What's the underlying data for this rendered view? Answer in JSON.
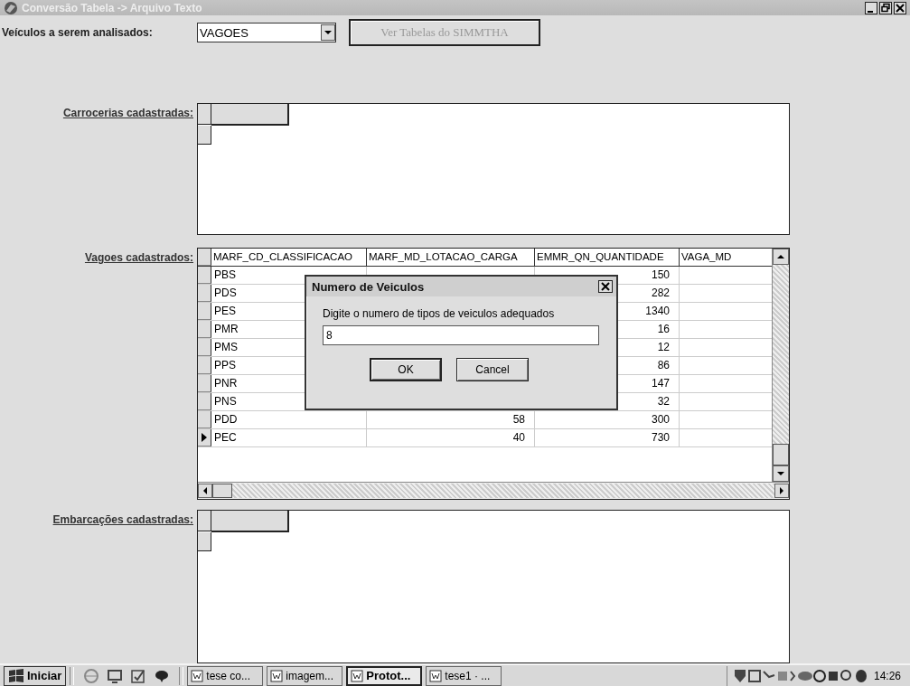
{
  "window": {
    "title": "Conversão Tabela -> Arquivo Texto"
  },
  "vehicle_select": {
    "label": "Veículos a serem analisados:",
    "value": "VAGOES"
  },
  "view_tables_button": {
    "label": "Ver Tabelas do SIMMTHA",
    "disabled": true
  },
  "sections": [
    {
      "label": "Carrocerias cadastradas:",
      "kind": "empty"
    },
    {
      "label": "Vagoes cadastrados:",
      "kind": "table"
    },
    {
      "label": "Embarcações cadastradas:",
      "kind": "empty"
    }
  ],
  "table": {
    "columns": [
      "MARF_CD_CLASSIFICACAO",
      "MARF_MD_LOTACAO_CARGA",
      "EMMR_QN_QUANTIDADE",
      "VAGA_MD"
    ],
    "rows": [
      {
        "code": "PBS",
        "quantity": "150",
        "selected": false
      },
      {
        "code": "PDS",
        "quantity": "282",
        "selected": false
      },
      {
        "code": "PES",
        "quantity": "1340",
        "selected": false
      },
      {
        "code": "PMR",
        "quantity": "16",
        "selected": false
      },
      {
        "code": "PMS",
        "quantity": "12",
        "selected": false
      },
      {
        "code": "PPS",
        "quantity": "86",
        "selected": false
      },
      {
        "code": "PNR",
        "quantity": "147",
        "selected": false
      },
      {
        "code": "PNS",
        "quantity": "32",
        "selected": false
      },
      {
        "code": "PDD",
        "capacity": "58",
        "quantity": "300",
        "selected": false
      },
      {
        "code": "PEC",
        "capacity": "40",
        "quantity": "730",
        "selected": true
      }
    ]
  },
  "dialog": {
    "title": "Numero de Veiculos",
    "prompt": "Digite o numero de tipos de veiculos adequados",
    "value": "8",
    "buttons": [
      "OK",
      "Cancel"
    ]
  },
  "taskbar": {
    "start": "Iniciar",
    "tasks": [
      {
        "label": "tese co...",
        "selected": false
      },
      {
        "label": "imagem...",
        "selected": false
      },
      {
        "label": "Protot...",
        "selected": true
      },
      {
        "label": "tese1 · ...",
        "selected": false
      }
    ],
    "clock": "14:26"
  }
}
